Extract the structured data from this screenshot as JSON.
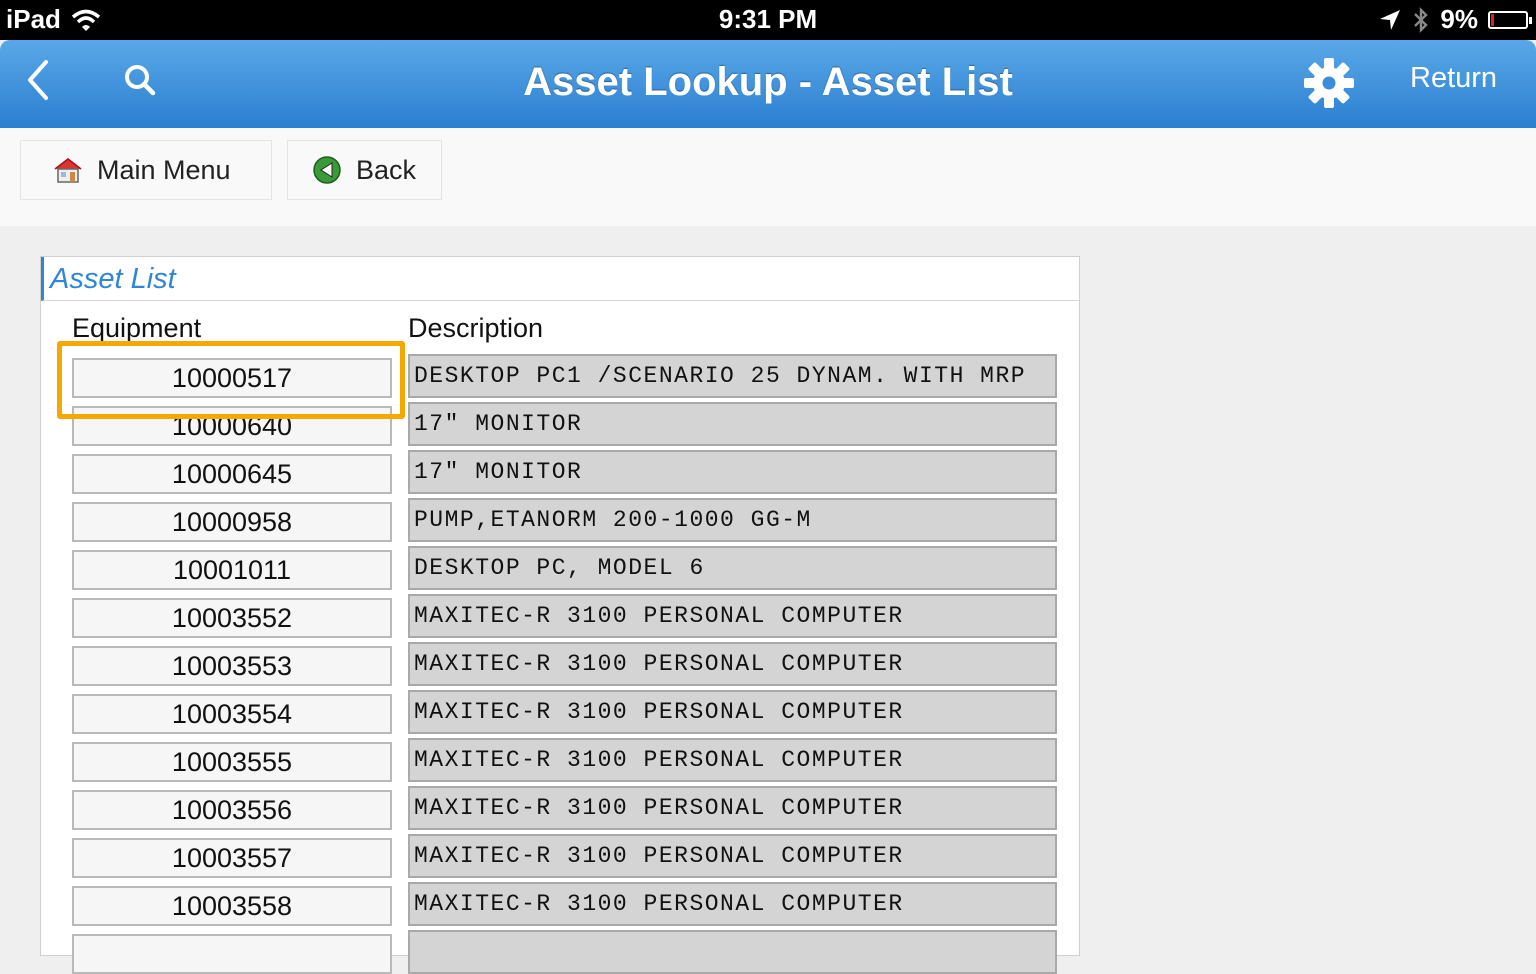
{
  "status_bar": {
    "device": "iPad",
    "time": "9:31 PM",
    "battery": "9%",
    "battery_level": 0.09
  },
  "nav": {
    "title": "Asset Lookup - Asset List",
    "return_label": "Return"
  },
  "toolbar": {
    "main_menu_label": "Main Menu",
    "back_label": "Back"
  },
  "panel": {
    "title": "Asset List",
    "col_equipment": "Equipment",
    "col_description": "Description"
  },
  "assets": [
    {
      "equipment": "10000517",
      "description": "DESKTOP PC1 /SCENARIO 25 DYNAM. WITH MRP"
    },
    {
      "equipment": "10000640",
      "description": "17\" MONITOR"
    },
    {
      "equipment": "10000645",
      "description": "17\" MONITOR"
    },
    {
      "equipment": "10000958",
      "description": "PUMP,ETANORM 200-1000 GG-M"
    },
    {
      "equipment": "10001011",
      "description": "DESKTOP PC, MODEL 6"
    },
    {
      "equipment": "10003552",
      "description": "MAXITEC-R 3100 PERSONAL COMPUTER"
    },
    {
      "equipment": "10003553",
      "description": "MAXITEC-R 3100 PERSONAL COMPUTER"
    },
    {
      "equipment": "10003554",
      "description": "MAXITEC-R 3100 PERSONAL COMPUTER"
    },
    {
      "equipment": "10003555",
      "description": "MAXITEC-R 3100 PERSONAL COMPUTER"
    },
    {
      "equipment": "10003556",
      "description": "MAXITEC-R 3100 PERSONAL COMPUTER"
    },
    {
      "equipment": "10003557",
      "description": "MAXITEC-R 3100 PERSONAL COMPUTER"
    },
    {
      "equipment": "10003558",
      "description": "MAXITEC-R 3100 PERSONAL COMPUTER"
    },
    {
      "equipment": "",
      "description": ""
    }
  ],
  "colors": {
    "nav_top": "#5aa8e8",
    "nav_bottom": "#2b7fd0",
    "highlight": "#f5a800",
    "panel_title": "#2f86d6"
  }
}
